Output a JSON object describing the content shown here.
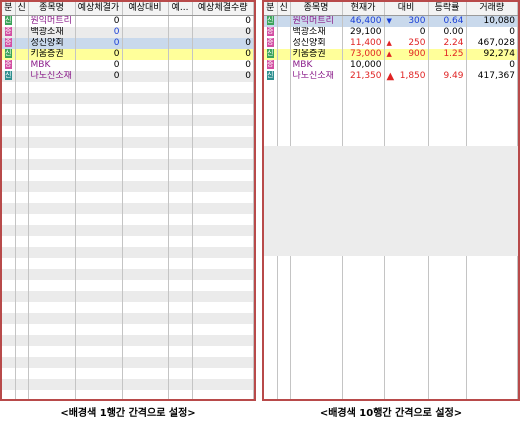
{
  "left": {
    "headers": [
      "분",
      "신",
      "종목명",
      "예상체결가",
      "예상대비",
      "예...",
      "예상체결수량"
    ],
    "rows": [
      {
        "badge": "신",
        "badge_color": "green",
        "name": "원익머트리",
        "name_color": "purple",
        "price": "0",
        "price_color": "black",
        "diff": "",
        "pct": "",
        "qty": "0",
        "style": "normal"
      },
      {
        "badge": "증",
        "badge_color": "pink",
        "name": "백광소재",
        "name_color": "black",
        "price": "0",
        "price_color": "blue",
        "diff": "",
        "pct": "",
        "qty": "0",
        "style": "normal"
      },
      {
        "badge": "증",
        "badge_color": "pink",
        "name": "성신양회",
        "name_color": "black",
        "price": "0",
        "price_color": "blue",
        "diff": "",
        "pct": "",
        "qty": "0",
        "style": "sel"
      },
      {
        "badge": "신",
        "badge_color": "green",
        "name": "키움증권",
        "name_color": "black",
        "price": "0",
        "price_color": "black",
        "diff": "",
        "pct": "",
        "qty": "0",
        "style": "yel"
      },
      {
        "badge": "증",
        "badge_color": "pink",
        "name": "MBK",
        "name_color": "purple",
        "price": "0",
        "price_color": "black",
        "diff": "",
        "pct": "",
        "qty": "0",
        "style": "normal"
      },
      {
        "badge": "신",
        "badge_color": "teal",
        "name": "나노신소재",
        "name_color": "purple",
        "price": "0",
        "price_color": "black",
        "diff": "",
        "pct": "",
        "qty": "0",
        "style": "normal"
      }
    ],
    "caption": "<배경색 1행간 간격으로 설정>"
  },
  "right": {
    "headers": [
      "분",
      "신",
      "종목명",
      "현재가",
      "대비",
      "등락률",
      "거래량"
    ],
    "rows": [
      {
        "badge": "신",
        "badge_color": "green",
        "name": "원익머트리",
        "name_color": "purple",
        "price": "46,400",
        "price_color": "blue",
        "arrow": "▼",
        "arrow_type": "down",
        "diff": "300",
        "diff_color": "blue",
        "pct": "0.64",
        "pct_color": "blue",
        "qty": "10,080",
        "style": "sel"
      },
      {
        "badge": "증",
        "badge_color": "pink",
        "name": "백광소재",
        "name_color": "black",
        "price": "29,100",
        "price_color": "black",
        "arrow": "",
        "arrow_type": "",
        "diff": "0",
        "diff_color": "black",
        "pct": "0.00",
        "pct_color": "black",
        "qty": "0",
        "style": "normal"
      },
      {
        "badge": "증",
        "badge_color": "pink",
        "name": "성신양회",
        "name_color": "black",
        "price": "11,400",
        "price_color": "red",
        "arrow": "▲",
        "arrow_type": "up",
        "diff": "250",
        "diff_color": "red",
        "pct": "2.24",
        "pct_color": "red",
        "qty": "467,028",
        "style": "normal"
      },
      {
        "badge": "신",
        "badge_color": "green",
        "name": "키움증권",
        "name_color": "black",
        "price": "73,000",
        "price_color": "red",
        "arrow": "▲",
        "arrow_type": "up",
        "diff": "900",
        "diff_color": "red",
        "pct": "1.25",
        "pct_color": "red",
        "qty": "92,274",
        "style": "yel"
      },
      {
        "badge": "증",
        "badge_color": "pink",
        "name": "MBK",
        "name_color": "purple",
        "price": "10,000",
        "price_color": "black",
        "arrow": "",
        "arrow_type": "",
        "diff": "",
        "diff_color": "black",
        "pct": "",
        "pct_color": "black",
        "qty": "0",
        "style": "normal"
      },
      {
        "badge": "신",
        "badge_color": "teal",
        "name": "나노신소재",
        "name_color": "purple",
        "price": "21,350",
        "price_color": "red",
        "arrow": "▲",
        "arrow_type": "upbig",
        "diff": "1,850",
        "diff_color": "red",
        "pct": "9.49",
        "pct_color": "red",
        "qty": "417,367",
        "style": "normal"
      }
    ],
    "caption": "<배경색 10행간 간격으로 설정>"
  }
}
